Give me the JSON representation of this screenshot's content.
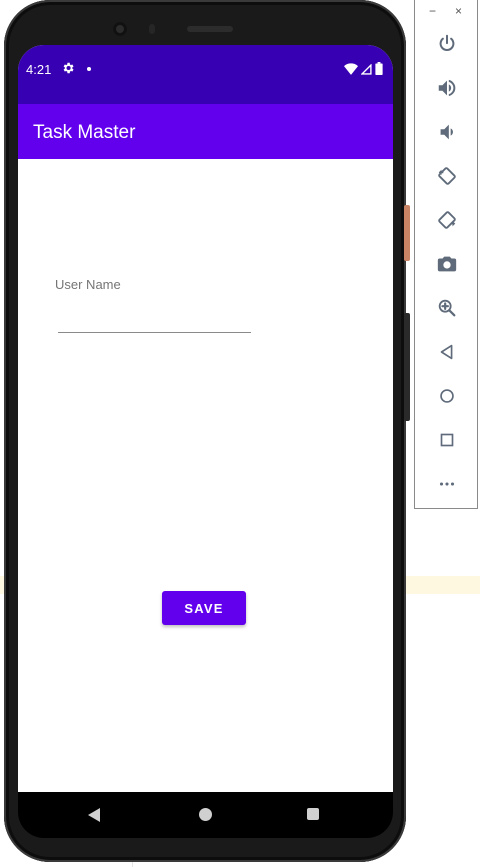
{
  "status_bar": {
    "time": "4:21"
  },
  "app_bar": {
    "title": "Task Master"
  },
  "form": {
    "user_name_label": "User Name",
    "user_name_value": "",
    "save_label": "SAVE"
  },
  "toolbar": {
    "minimize_label": "−",
    "close_label": "×",
    "buttons": [
      "power-icon",
      "volume-up-icon",
      "volume-down-icon",
      "rotate-left-icon",
      "rotate-right-icon",
      "camera-icon",
      "zoom-icon",
      "back-icon",
      "home-icon",
      "overview-icon",
      "more-icon"
    ]
  },
  "colors": {
    "status_bar": "#3700b3",
    "primary": "#6200ee",
    "toolbar_icon": "#5f6b7a"
  }
}
